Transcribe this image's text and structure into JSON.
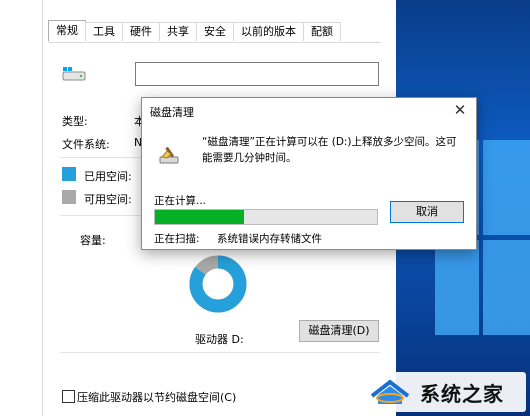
{
  "properties": {
    "tabs": [
      "常规",
      "工具",
      "硬件",
      "共享",
      "安全",
      "以前的版本",
      "配额"
    ],
    "active_tab": "常规",
    "name_value": "",
    "type_label": "类型:",
    "type_value_partial": "本",
    "fs_label": "文件系统:",
    "fs_value_partial": "N",
    "used_label": "已用空间:",
    "free_label": "可用空间:",
    "capacity_label": "容量:",
    "drive_label": "驱动器 D:",
    "cleanup_button": "磁盘清理(D)",
    "compress_label": "压缩此驱动器以节约磁盘空间(C)",
    "colors": {
      "used": "#26a0da",
      "free": "#a9a9a9"
    },
    "used_fraction": 0.85
  },
  "dialog": {
    "title": "磁盘清理",
    "close_icon": "close-icon",
    "message": "“磁盘清理”正在计算可以在 (D:)上释放多少空间。这可能需要几分钟时间。",
    "calculating": "正在计算...",
    "progress": 0.4,
    "cancel": "取消",
    "scanning_label": "正在扫描:",
    "scanning_item": "系统错误内存转储文件"
  },
  "watermark": {
    "text": "系统之家"
  }
}
